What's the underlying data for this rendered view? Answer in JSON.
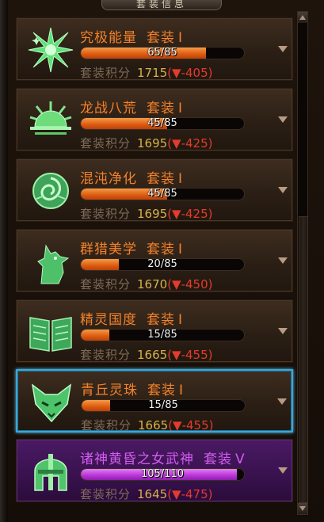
{
  "panel": {
    "title": "套装信息"
  },
  "colors": {
    "orange_text": "#f4822a",
    "purple_text": "#d35cf0",
    "selected_border": "#3aa6d8",
    "score_value": "#d7b04a",
    "delta_down": "#e33b2e"
  },
  "sets": [
    {
      "name": "究极能量",
      "tier": "套装",
      "level": "I",
      "progress_text": "65/85",
      "progress": 0.765,
      "score_label": "套装积分",
      "score": "1715",
      "delta": "(▼-405)",
      "icon": "starburst-icon",
      "selected": false,
      "style": "orange"
    },
    {
      "name": "龙战八荒",
      "tier": "套装",
      "level": "I",
      "progress_text": "45/85",
      "progress": 0.529,
      "score_label": "套装积分",
      "score": "1695",
      "delta": "(▼-425)",
      "icon": "rising-sun-icon",
      "selected": false,
      "style": "orange"
    },
    {
      "name": "混沌净化",
      "tier": "套装",
      "level": "I",
      "progress_text": "45/85",
      "progress": 0.529,
      "score_label": "套装积分",
      "score": "1695",
      "delta": "(▼-425)",
      "icon": "rose-icon",
      "selected": false,
      "style": "orange"
    },
    {
      "name": "群猎美学",
      "tier": "套装",
      "level": "I",
      "progress_text": "20/85",
      "progress": 0.235,
      "score_label": "套装积分",
      "score": "1670",
      "delta": "(▼-450)",
      "icon": "wolf-icon",
      "selected": false,
      "style": "orange"
    },
    {
      "name": "精灵国度",
      "tier": "套装",
      "level": "I",
      "progress_text": "15/85",
      "progress": 0.176,
      "score_label": "套装积分",
      "score": "1665",
      "delta": "(▼-455)",
      "icon": "book-icon",
      "selected": false,
      "style": "orange"
    },
    {
      "name": "青丘灵珠",
      "tier": "套装",
      "level": "I",
      "progress_text": "15/85",
      "progress": 0.176,
      "score_label": "套装积分",
      "score": "1665",
      "delta": "(▼-455)",
      "icon": "fox-icon",
      "selected": true,
      "style": "orange"
    },
    {
      "name": "诸神黄昏之女武神",
      "tier": "套装",
      "level": "V",
      "progress_text": "105/110",
      "progress": 0.955,
      "score_label": "套装积分",
      "score": "1645",
      "delta": "(▼-475)",
      "icon": "valkyrie-helmet-icon",
      "selected": false,
      "style": "purple"
    }
  ]
}
